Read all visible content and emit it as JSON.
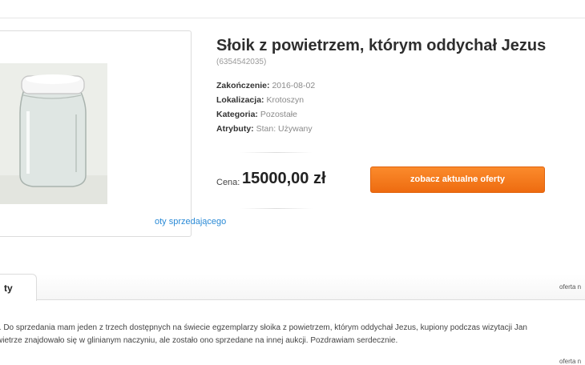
{
  "listing": {
    "title": "Słoik z powietrzem, którym oddychał Jezus",
    "id": "(6354542035)",
    "attributes": [
      {
        "key": "Zakończenie:",
        "value": " 2016-08-02"
      },
      {
        "key": "Lokalizacja:",
        "value": " Krotoszyn"
      },
      {
        "key": "Kategoria:",
        "value": " Pozostałe"
      },
      {
        "key": "Atrybuty:",
        "value": "  Stan: Używany"
      }
    ],
    "price_label": "Cena:",
    "price": "15000,00 zł",
    "offers_button": "zobacz aktualne oferty",
    "photo_link": "oty sprzedającego"
  },
  "tabs": {
    "active": "ty",
    "offer_no": "oferta n"
  },
  "description": {
    "line1": "t. Do sprzedania mam jeden z trzech dostępnych na świecie egzemplarzy słoika z powietrzem, którym oddychał Jezus, kupiony podczas wizytacji Jan",
    "line2": "wietrze znajdowało się w glinianym naczyniu, ale zostało ono sprzedane na innej aukcji. Pozdrawiam serdecznie."
  },
  "footer": {
    "offer_no": "oferta n"
  },
  "colors": {
    "button_orange": "#f07a1c",
    "link_blue": "#2a8ad6"
  }
}
